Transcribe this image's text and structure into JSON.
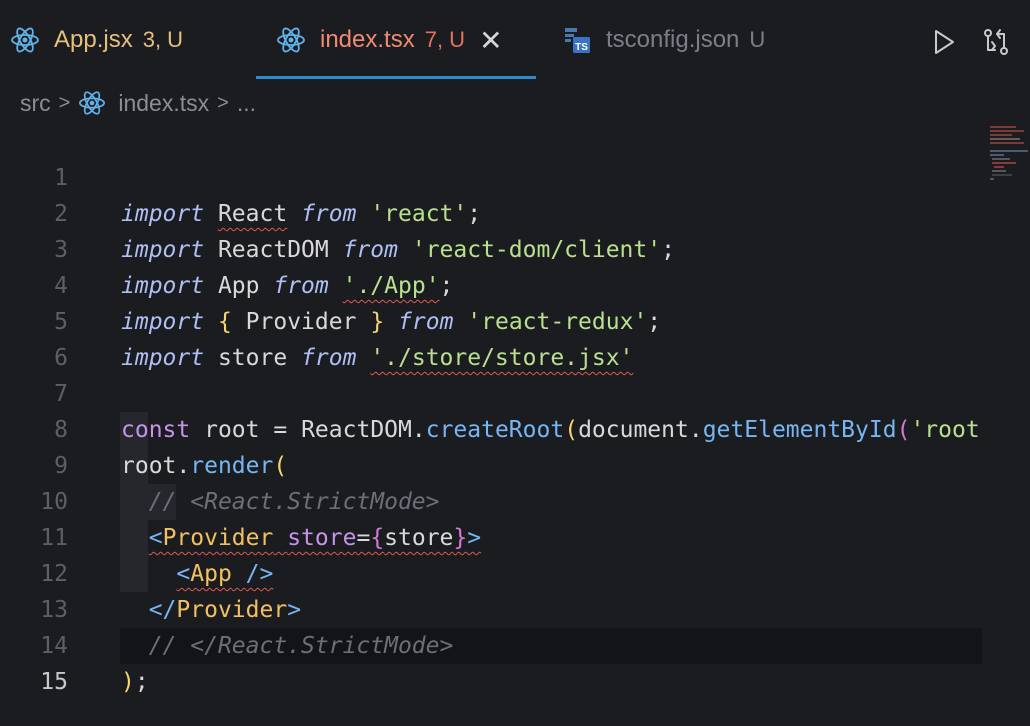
{
  "tabs": [
    {
      "label": "App.jsx",
      "badge": "3, U",
      "icon": "react-icon"
    },
    {
      "label": "index.tsx",
      "badge": "7, U",
      "icon": "react-icon",
      "active": true,
      "close": "✕"
    },
    {
      "label": "tsconfig.json",
      "badge": "U",
      "icon": "typescript-config-icon"
    }
  ],
  "actions": {
    "run": "run-icon",
    "compare": "source-control-compare-icon"
  },
  "breadcrumb": {
    "folder": "src",
    "file": "index.tsx",
    "more": "..."
  },
  "editor": {
    "line_numbers": [
      "1",
      "2",
      "3",
      "4",
      "5",
      "6",
      "7",
      "8",
      "9",
      "10",
      "11",
      "12",
      "13",
      "14",
      "15"
    ],
    "current_line": 15,
    "lines": {
      "l1": {
        "k": "import",
        "a": "React",
        "f": "from",
        "s": "'react'",
        "e": ";"
      },
      "l2": {
        "k": "import",
        "a": "ReactDOM",
        "f": "from",
        "s": "'react-dom/client'",
        "e": ";"
      },
      "l3": {
        "k": "import",
        "a": "App",
        "f": "from",
        "s": "'./App'",
        "e": ";"
      },
      "l4": {
        "k": "import",
        "b1": "{",
        "a": "Provider",
        "b2": "}",
        "f": "from",
        "s": "'react-redux'",
        "e": ";"
      },
      "l5": {
        "k": "import",
        "a": "store",
        "f": "from",
        "s": "'./store/store.jsx'"
      },
      "l7": {
        "k": "const",
        "v": "root",
        "eq": "=",
        "o": "ReactDOM",
        "d1": ".",
        "m1": "createRoot",
        "p1": "(",
        "doc": "document",
        "d2": ".",
        "m2": "getElementById",
        "p2": "(",
        "s": "'root'"
      },
      "l8": {
        "o": "root",
        "d": ".",
        "m": "render",
        "p": "("
      },
      "l9": {
        "c": "// <React.StrictMode>"
      },
      "l10": {
        "lt": "<",
        "tag": "Provider",
        "attr": "store",
        "eq": "=",
        "b1": "{",
        "v": "store",
        "b2": "}",
        "gt": ">"
      },
      "l11": {
        "lt": "<",
        "tag": "App",
        "end": "/>"
      },
      "l12": {
        "lt": "</",
        "tag": "Provider",
        "gt": ">"
      },
      "l13": {
        "c": "// </React.StrictMode>"
      },
      "l14": {
        "p": ")",
        "e": ";"
      }
    }
  },
  "colors": {
    "background": "#1b1c20",
    "accent": "#2c8ad1",
    "error": "#e0574d",
    "warning": "#e6c07b"
  }
}
